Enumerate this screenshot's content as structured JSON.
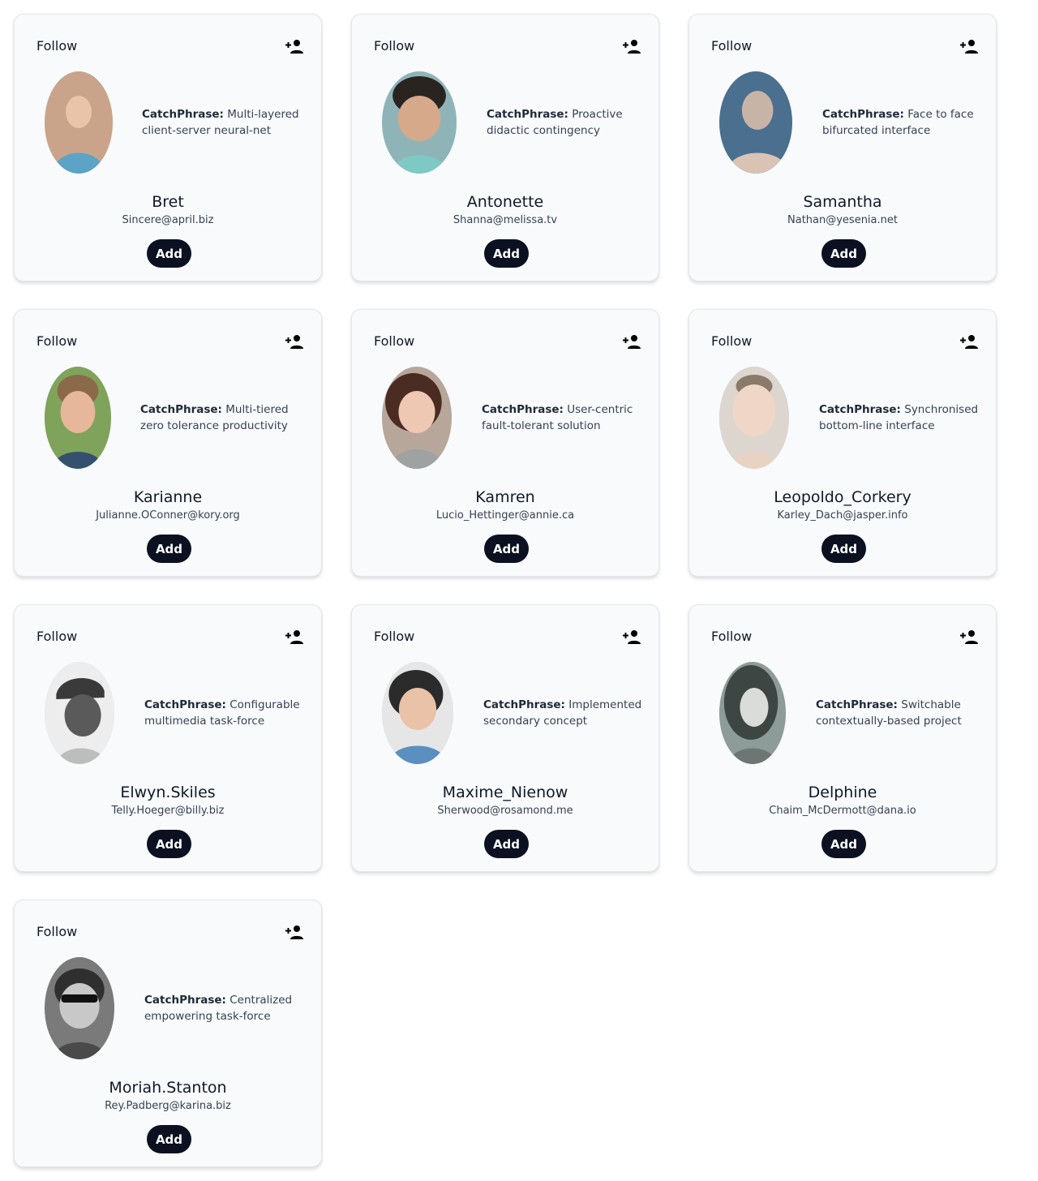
{
  "common": {
    "follow_label": "Follow",
    "catchphrase_label": "CatchPhrase:",
    "add_label": "Add",
    "follow_icon": "person-add-icon"
  },
  "cards": [
    {
      "username": "Bret",
      "email": "Sincere@april.biz",
      "catchphrase": "Multi-layered client-server neural-net",
      "avatar_color": "#c9a48a"
    },
    {
      "username": "Antonette",
      "email": "Shanna@melissa.tv",
      "catchphrase": "Proactive didactic contingency",
      "avatar_color": "#8fb4b8"
    },
    {
      "username": "Samantha",
      "email": "Nathan@yesenia.net",
      "catchphrase": "Face to face bifurcated interface",
      "avatar_color": "#4a6f8f"
    },
    {
      "username": "Karianne",
      "email": "Julianne.OConner@kory.org",
      "catchphrase": "Multi-tiered zero tolerance productivity",
      "avatar_color": "#7fa35a"
    },
    {
      "username": "Kamren",
      "email": "Lucio_Hettinger@annie.ca",
      "catchphrase": "User-centric fault-tolerant solution",
      "avatar_color": "#b7a79b"
    },
    {
      "username": "Leopoldo_Corkery",
      "email": "Karley_Dach@jasper.info",
      "catchphrase": "Synchronised bottom-line interface",
      "avatar_color": "#ddd6cf"
    },
    {
      "username": "Elwyn.Skiles",
      "email": "Telly.Hoeger@billy.biz",
      "catchphrase": "Configurable multimedia task-force",
      "avatar_color": "#cfcfcf"
    },
    {
      "username": "Maxime_Nienow",
      "email": "Sherwood@rosamond.me",
      "catchphrase": "Implemented secondary concept",
      "avatar_color": "#5a8fc0"
    },
    {
      "username": "Delphine",
      "email": "Chaim_McDermott@dana.io",
      "catchphrase": "Switchable contextually-based project",
      "avatar_color": "#8d9c98"
    },
    {
      "username": "Moriah.Stanton",
      "email": "Rey.Padberg@karina.biz",
      "catchphrase": "Centralized empowering task-force",
      "avatar_color": "#7a7a7a"
    }
  ]
}
